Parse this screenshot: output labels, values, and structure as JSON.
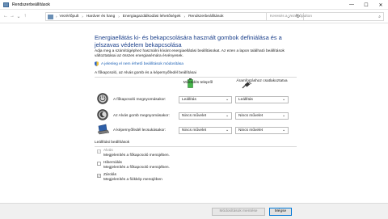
{
  "window": {
    "title": "Rendszerbeállítások",
    "controls": {
      "minimize": "—",
      "maximize": "☐",
      "close": "✕"
    }
  },
  "addressbar": {
    "breadcrumbs": [
      "Vezérlőpult",
      "Hardver és hang",
      "Energiagazdálkodási lehetőségek",
      "Rendszerbeállítások"
    ],
    "search_placeholder": "Keresés a Vezérlőpulton"
  },
  "main": {
    "heading": "Energiaellátás ki- és bekapcsolására használt gombok definiálása és a jelszavas védelem bekapcsolása",
    "intro": "Adja meg a számítógéphez használni kívánt energiaellátási beállításokat. Az ezen a lapon található beállítások változtatásai az összes energiasémára érvényesek.",
    "link": "A jelenleg el nem érhető beállítások módosítása",
    "buttons_section": {
      "title": "A főkapcsoló, az Alvás gomb és a képernyőfedél beállításai",
      "col_battery": "Működés telepről",
      "col_plugged": "Áramforráshoz csatlakoztatva",
      "rows": [
        {
          "label": "A főkapcsoló megnyomásakor:",
          "battery": "Leállítás",
          "plugged": "Leállítás"
        },
        {
          "label": "Az Alvás gomb megnyomásakor:",
          "battery": "Nincs művelet",
          "plugged": "Nincs művelet"
        },
        {
          "label": "A képernyőfedél lecsukásakor:",
          "battery": "Nincs művelet",
          "plugged": "Nincs művelet"
        }
      ]
    },
    "shutdown_section": {
      "title": "Leállítási beállítások",
      "items": [
        {
          "title": "Alvás",
          "desc": "Megjelenítés a főkapcsoló menüjében.",
          "checked": true,
          "disabled": true
        },
        {
          "title": "Hibernálás",
          "desc": "Megjelenítés a főkapcsoló menüjében.",
          "checked": false,
          "disabled": false
        },
        {
          "title": "Zárolás",
          "desc": "Megjelenítés a fiókkép menüjében",
          "checked": true,
          "disabled": false
        }
      ]
    }
  },
  "footer": {
    "save_label": "Módosítások mentése",
    "cancel_label": "Mégse"
  }
}
